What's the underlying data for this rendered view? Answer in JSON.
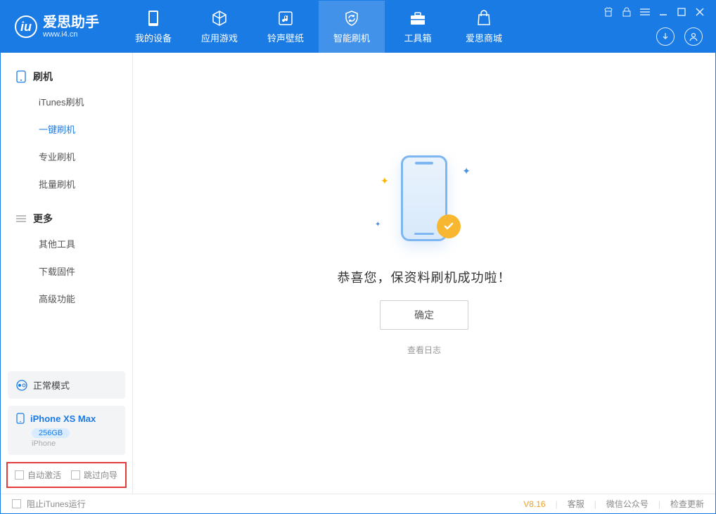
{
  "app": {
    "title": "爱思助手",
    "subtitle": "www.i4.cn"
  },
  "nav": {
    "items": [
      {
        "label": "我的设备"
      },
      {
        "label": "应用游戏"
      },
      {
        "label": "铃声壁纸"
      },
      {
        "label": "智能刷机"
      },
      {
        "label": "工具箱"
      },
      {
        "label": "爱思商城"
      }
    ]
  },
  "sidebar": {
    "section1": "刷机",
    "items1": [
      {
        "label": "iTunes刷机"
      },
      {
        "label": "一键刷机"
      },
      {
        "label": "专业刷机"
      },
      {
        "label": "批量刷机"
      }
    ],
    "section2": "更多",
    "items2": [
      {
        "label": "其他工具"
      },
      {
        "label": "下载固件"
      },
      {
        "label": "高级功能"
      }
    ],
    "mode": "正常模式",
    "device": {
      "name": "iPhone XS Max",
      "capacity": "256GB",
      "type": "iPhone"
    },
    "options": {
      "auto_activate": "自动激活",
      "skip_guide": "跳过向导"
    }
  },
  "main": {
    "message": "恭喜您，保资料刷机成功啦！",
    "ok": "确定",
    "view_log": "查看日志"
  },
  "status": {
    "block_itunes": "阻止iTunes运行",
    "version": "V8.16",
    "support": "客服",
    "wechat": "微信公众号",
    "update": "检查更新"
  }
}
